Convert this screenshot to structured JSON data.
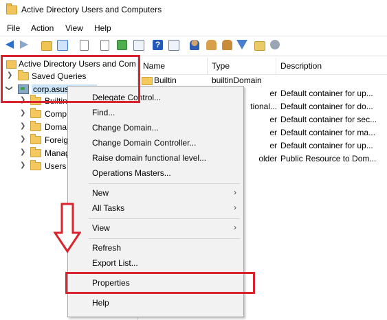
{
  "window": {
    "title": "Active Directory Users and Computers",
    "icon": "folder-icon"
  },
  "menubar": {
    "items": [
      "File",
      "Action",
      "View",
      "Help"
    ]
  },
  "toolbar": {
    "buttons": [
      "back-arrow-icon",
      "forward-arrow-icon",
      "up-folder-icon",
      "show-console-tree-icon",
      "clipboard-icon",
      "export-list-icon",
      "refresh-icon",
      "export-icon",
      "help-icon",
      "console-icon",
      "user-icon",
      "users-icon",
      "group-icon",
      "filter-icon",
      "folder-open-icon",
      "delegate-icon"
    ]
  },
  "tree": {
    "root": "Active Directory Users and Com",
    "items": [
      {
        "label": "Saved Queries",
        "expanded": false
      },
      {
        "label": "corp.asustor.com",
        "expanded": true,
        "selected": true
      }
    ],
    "children": [
      "Builtin",
      "Comp",
      "Domai",
      "Foreig",
      "Manag",
      "Users"
    ]
  },
  "list": {
    "columns": [
      "Name",
      "Type",
      "Description"
    ],
    "rows": [
      {
        "name": "Builtin",
        "type": "builtinDomain",
        "description": ""
      },
      {
        "name": "",
        "type": "er",
        "description": "Default container for up..."
      },
      {
        "name": "",
        "type": "tional...",
        "description": "Default container for do..."
      },
      {
        "name": "",
        "type": "er",
        "description": "Default container for sec..."
      },
      {
        "name": "",
        "type": "er",
        "description": "Default container for ma..."
      },
      {
        "name": "",
        "type": "er",
        "description": "Default container for up..."
      },
      {
        "name": "",
        "type": "older",
        "description": "Public Resource to Dom..."
      }
    ]
  },
  "context_menu": {
    "items": [
      {
        "label": "Delegate Control...",
        "submenu": false
      },
      {
        "label": "Find...",
        "submenu": false
      },
      {
        "label": "Change Domain...",
        "submenu": false
      },
      {
        "label": "Change Domain Controller...",
        "submenu": false
      },
      {
        "label": "Raise domain functional level...",
        "submenu": false
      },
      {
        "label": "Operations Masters...",
        "submenu": false
      },
      {
        "label": "New",
        "submenu": true
      },
      {
        "label": "All Tasks",
        "submenu": true
      },
      {
        "label": "View",
        "submenu": true
      },
      {
        "label": "Refresh",
        "submenu": false
      },
      {
        "label": "Export List...",
        "submenu": false
      },
      {
        "label": "Properties",
        "submenu": false,
        "highlighted": true
      },
      {
        "label": "Help",
        "submenu": false
      }
    ],
    "submenu_glyph": "›"
  },
  "annotations": {
    "highlight_color": "#d9232e"
  }
}
